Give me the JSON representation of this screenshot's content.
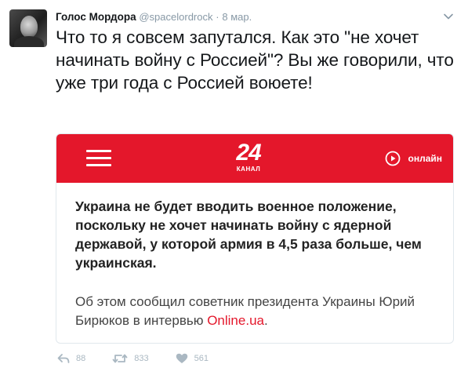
{
  "tweet": {
    "author_name": "Голос Мордора",
    "handle": "@spacelordrock",
    "separator": "·",
    "date": "8 мар.",
    "text": "Что то я совсем запутался. Как это \"не хочет начинать войну с Россией\"? Вы же говорили, что уже три года с Россией воюете!"
  },
  "card": {
    "logo_number": "24",
    "logo_subtitle": "КАНАЛ",
    "live_label": "онлайн",
    "headline": "Украина не будет вводить военное положение, поскольку не хочет начинать войну с ядерной державой, у которой армия в 4,5 раза больше, чем украинская.",
    "body_prefix": "Об этом сообщил советник президента Украины Юрий Бирюков в интервью ",
    "body_link": "Online.ua",
    "body_suffix": ".",
    "brand_color": "#e4172b"
  },
  "actions": {
    "reply_count": "88",
    "retweet_count": "833",
    "like_count": "561"
  },
  "icons": [
    "avatar",
    "chevron-down-icon",
    "hamburger-icon",
    "play-circle-icon",
    "reply-icon",
    "retweet-icon",
    "heart-icon"
  ]
}
